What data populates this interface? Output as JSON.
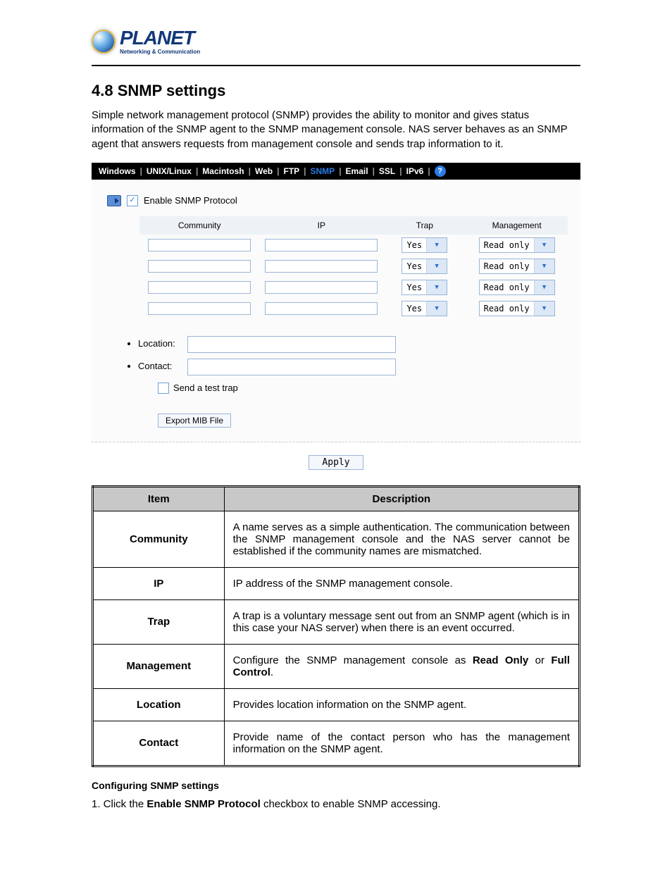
{
  "brand": {
    "name": "PLANET",
    "tag": "Networking & Communication"
  },
  "heading": "4.8 SNMP settings",
  "intro": "Simple network management protocol (SNMP) provides the ability to monitor and gives status information of the SNMP agent to the SNMP management console. NAS server behaves as an SNMP agent that answers requests from management console and sends trap information to it.",
  "tabs": {
    "items": [
      "Windows",
      "UNIX/Linux",
      "Macintosh",
      "Web",
      "FTP",
      "SNMP",
      "Email",
      "SSL",
      "IPv6"
    ],
    "active": "SNMP",
    "help": "?"
  },
  "form": {
    "enable_label": "Enable SNMP Protocol",
    "enable_checked": true,
    "headers": {
      "community": "Community",
      "ip": "IP",
      "trap": "Trap",
      "mgmt": "Management"
    },
    "rows": [
      {
        "community": "",
        "ip": "",
        "trap": "Yes",
        "mgmt": "Read only"
      },
      {
        "community": "",
        "ip": "",
        "trap": "Yes",
        "mgmt": "Read only"
      },
      {
        "community": "",
        "ip": "",
        "trap": "Yes",
        "mgmt": "Read only"
      },
      {
        "community": "",
        "ip": "",
        "trap": "Yes",
        "mgmt": "Read only"
      }
    ],
    "location_label": "Location:",
    "location_value": "",
    "contact_label": "Contact:",
    "contact_value": "",
    "test_trap_label": "Send a test trap",
    "test_trap_checked": false,
    "export_label": "Export MIB File",
    "apply_label": "Apply"
  },
  "desc_table": {
    "head_item": "Item",
    "head_desc": "Description",
    "rows": [
      {
        "item": "Community",
        "desc": "A name serves as a simple authentication. The communication between the SNMP management console and the NAS server cannot be established if the community names are mismatched."
      },
      {
        "item": "IP",
        "desc": "IP address of the SNMP management console."
      },
      {
        "item": "Trap",
        "desc": "A trap is a voluntary message sent out from an SNMP agent (which is in this case your NAS server) when there is an event occurred."
      },
      {
        "item": "Management",
        "desc_prefix": "Configure the SNMP management console as ",
        "bold1": "Read Only",
        "mid": " or ",
        "bold2": "Full Control",
        "suffix": "."
      },
      {
        "item": "Location",
        "desc": "Provides location information on the SNMP agent."
      },
      {
        "item": "Contact",
        "desc": "Provide name of the contact person who has the management information on the SNMP agent."
      }
    ]
  },
  "config_heading": "Configuring SNMP settings",
  "config_step_prefix": "1. Click the ",
  "config_step_bold": "Enable SNMP Protocol",
  "config_step_suffix": " checkbox to enable SNMP accessing."
}
